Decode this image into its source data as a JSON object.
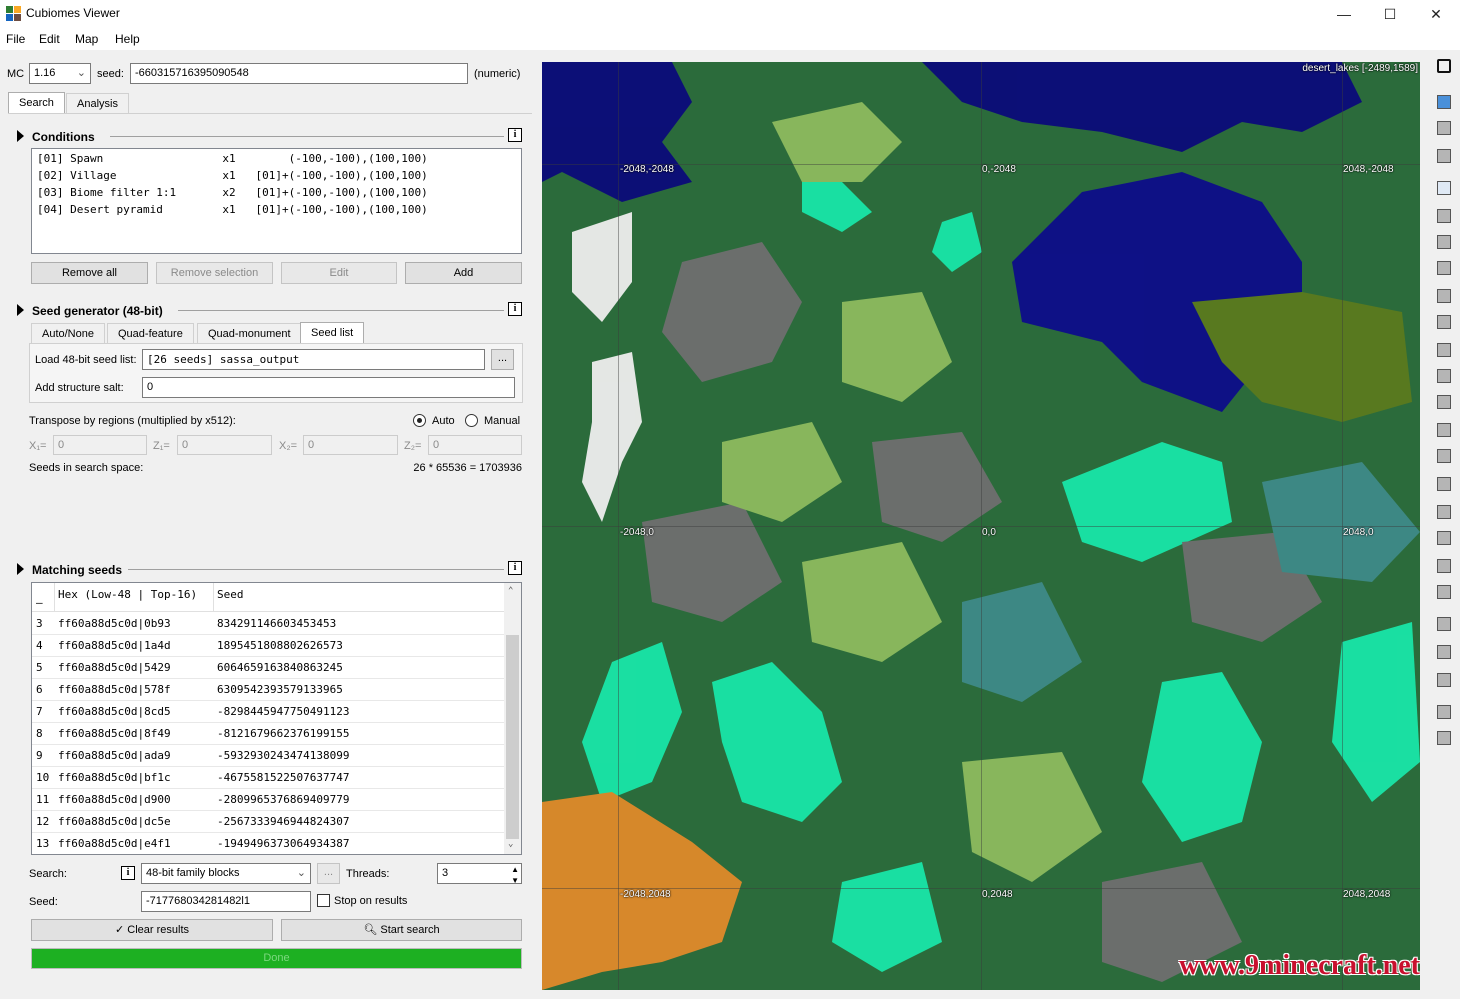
{
  "window": {
    "title": "Cubiomes Viewer",
    "minimize": "—",
    "maximize": "☐",
    "close": "✕"
  },
  "menu": [
    "File",
    "Edit",
    "Map",
    "Help"
  ],
  "topbar": {
    "mc_label": "MC",
    "mc_version": "1.16",
    "seed_label": "seed:",
    "seed_value": "-660315716395090548",
    "seed_type": "(numeric)"
  },
  "tabs": [
    "Search",
    "Analysis"
  ],
  "conditions": {
    "title": "Conditions",
    "info": "i",
    "rows": [
      "[01] Spawn                  x1        (-100,-100),(100,100)",
      "[02] Village                x1   [01]+(-100,-100),(100,100)",
      "[03] Biome filter 1:1       x2   [01]+(-100,-100),(100,100)",
      "[04] Desert pyramid         x1   [01]+(-100,-100),(100,100)"
    ],
    "buttons": {
      "remove_all": "Remove all",
      "remove_selection": "Remove selection",
      "edit": "Edit",
      "add": "Add"
    }
  },
  "seed_generator": {
    "title": "Seed generator (48-bit)",
    "info": "i",
    "tabs": [
      "Auto/None",
      "Quad-feature",
      "Quad-monument",
      "Seed list"
    ],
    "load_label": "Load 48-bit seed list:",
    "load_value": "[26 seeds] sassa_output",
    "browse": "...",
    "salt_label": "Add structure salt:",
    "salt_value": "0",
    "transpose_label": "Transpose by regions (multiplied by x512):",
    "auto_label": "Auto",
    "manual_label": "Manual",
    "x1_label": "X₁=",
    "x1_value": "0",
    "z1_label": "Z₁=",
    "z1_value": "0",
    "x2_label": "X₂=",
    "x2_value": "0",
    "z2_label": "Z₂=",
    "z2_value": "0",
    "space_label": "Seeds in search space:",
    "space_value": "26 * 65536 = 1703936"
  },
  "matching": {
    "title": "Matching seeds",
    "info": "i",
    "col_index": "–",
    "col_hex": "Hex  (Low-48 | Top-16)",
    "col_seed": "Seed",
    "rows": [
      {
        "idx": "3",
        "hex": "ff60a88d5c0d|0b93",
        "seed": "834291146603453453"
      },
      {
        "idx": "4",
        "hex": "ff60a88d5c0d|1a4d",
        "seed": "1895451808802626573"
      },
      {
        "idx": "5",
        "hex": "ff60a88d5c0d|5429",
        "seed": "6064659163840863245"
      },
      {
        "idx": "6",
        "hex": "ff60a88d5c0d|578f",
        "seed": "6309542393579133965"
      },
      {
        "idx": "7",
        "hex": "ff60a88d5c0d|8cd5",
        "seed": "-8298445947750491123"
      },
      {
        "idx": "8",
        "hex": "ff60a88d5c0d|8f49",
        "seed": "-8121679662376199155"
      },
      {
        "idx": "9",
        "hex": "ff60a88d5c0d|ada9",
        "seed": "-5932930243474138099"
      },
      {
        "idx": "10",
        "hex": "ff60a88d5c0d|bf1c",
        "seed": "-4675581522507637747"
      },
      {
        "idx": "11",
        "hex": "ff60a88d5c0d|d900",
        "seed": "-2809965376869409779"
      },
      {
        "idx": "12",
        "hex": "ff60a88d5c0d|dc5e",
        "seed": "-2567333946944824307"
      },
      {
        "idx": "13",
        "hex": "ff60a88d5c0d|e4f1",
        "seed": "-1949496373064934387"
      }
    ]
  },
  "search": {
    "search_label": "Search:",
    "info": "i",
    "mode": "48-bit family blocks",
    "more": "...",
    "threads_label": "Threads:",
    "threads_value": "3",
    "seed_label": "Seed:",
    "seed_value": "-717768034281482l1",
    "stop_label": "Stop on results",
    "clear_label": "Clear results",
    "start_label": "Start search",
    "progress_label": "Done",
    "progress": 1.0
  },
  "map": {
    "hover_label": "desert_lakes [-2489,1589]",
    "coords": {
      "tl": "-2048,-2048",
      "tm": "0,-2048",
      "tr": "2048,-2048",
      "ml": "-2048,0",
      "mm": "0,0",
      "mr": "2048,0",
      "bl": "-2048,2048",
      "bm": "0,2048",
      "br": "2048,2048"
    },
    "watermark": "www.9minecraft.net"
  },
  "toolbar_icons": [
    "crosshair-icon",
    "biome-layer-icon",
    "height-layer-icon",
    "terrain-layer-icon",
    "grid-icon",
    "slime-chunk-icon",
    "village-icon",
    "desert-pyramid-icon",
    "jungle-temple-icon",
    "swamp-hut-icon",
    "igloo-icon",
    "monument-icon",
    "mansion-icon",
    "outpost-icon",
    "ruined-portal-icon",
    "shipwreck-icon",
    "treasure-icon",
    "mineshaft-icon",
    "bastion-icon",
    "fortress-icon",
    "end-city-icon",
    "end-gateway-icon",
    "stronghold-icon",
    "spawn-icon",
    "player-icon"
  ],
  "colors": {
    "progress": "#1db022",
    "ocean": "#0b0b7a",
    "forest": "#2b6b3b",
    "plains": "#8dbb5e",
    "mountains": "#6f6f6f",
    "warm_ocean": "#19e6a8",
    "badlands": "#e08a2a"
  }
}
